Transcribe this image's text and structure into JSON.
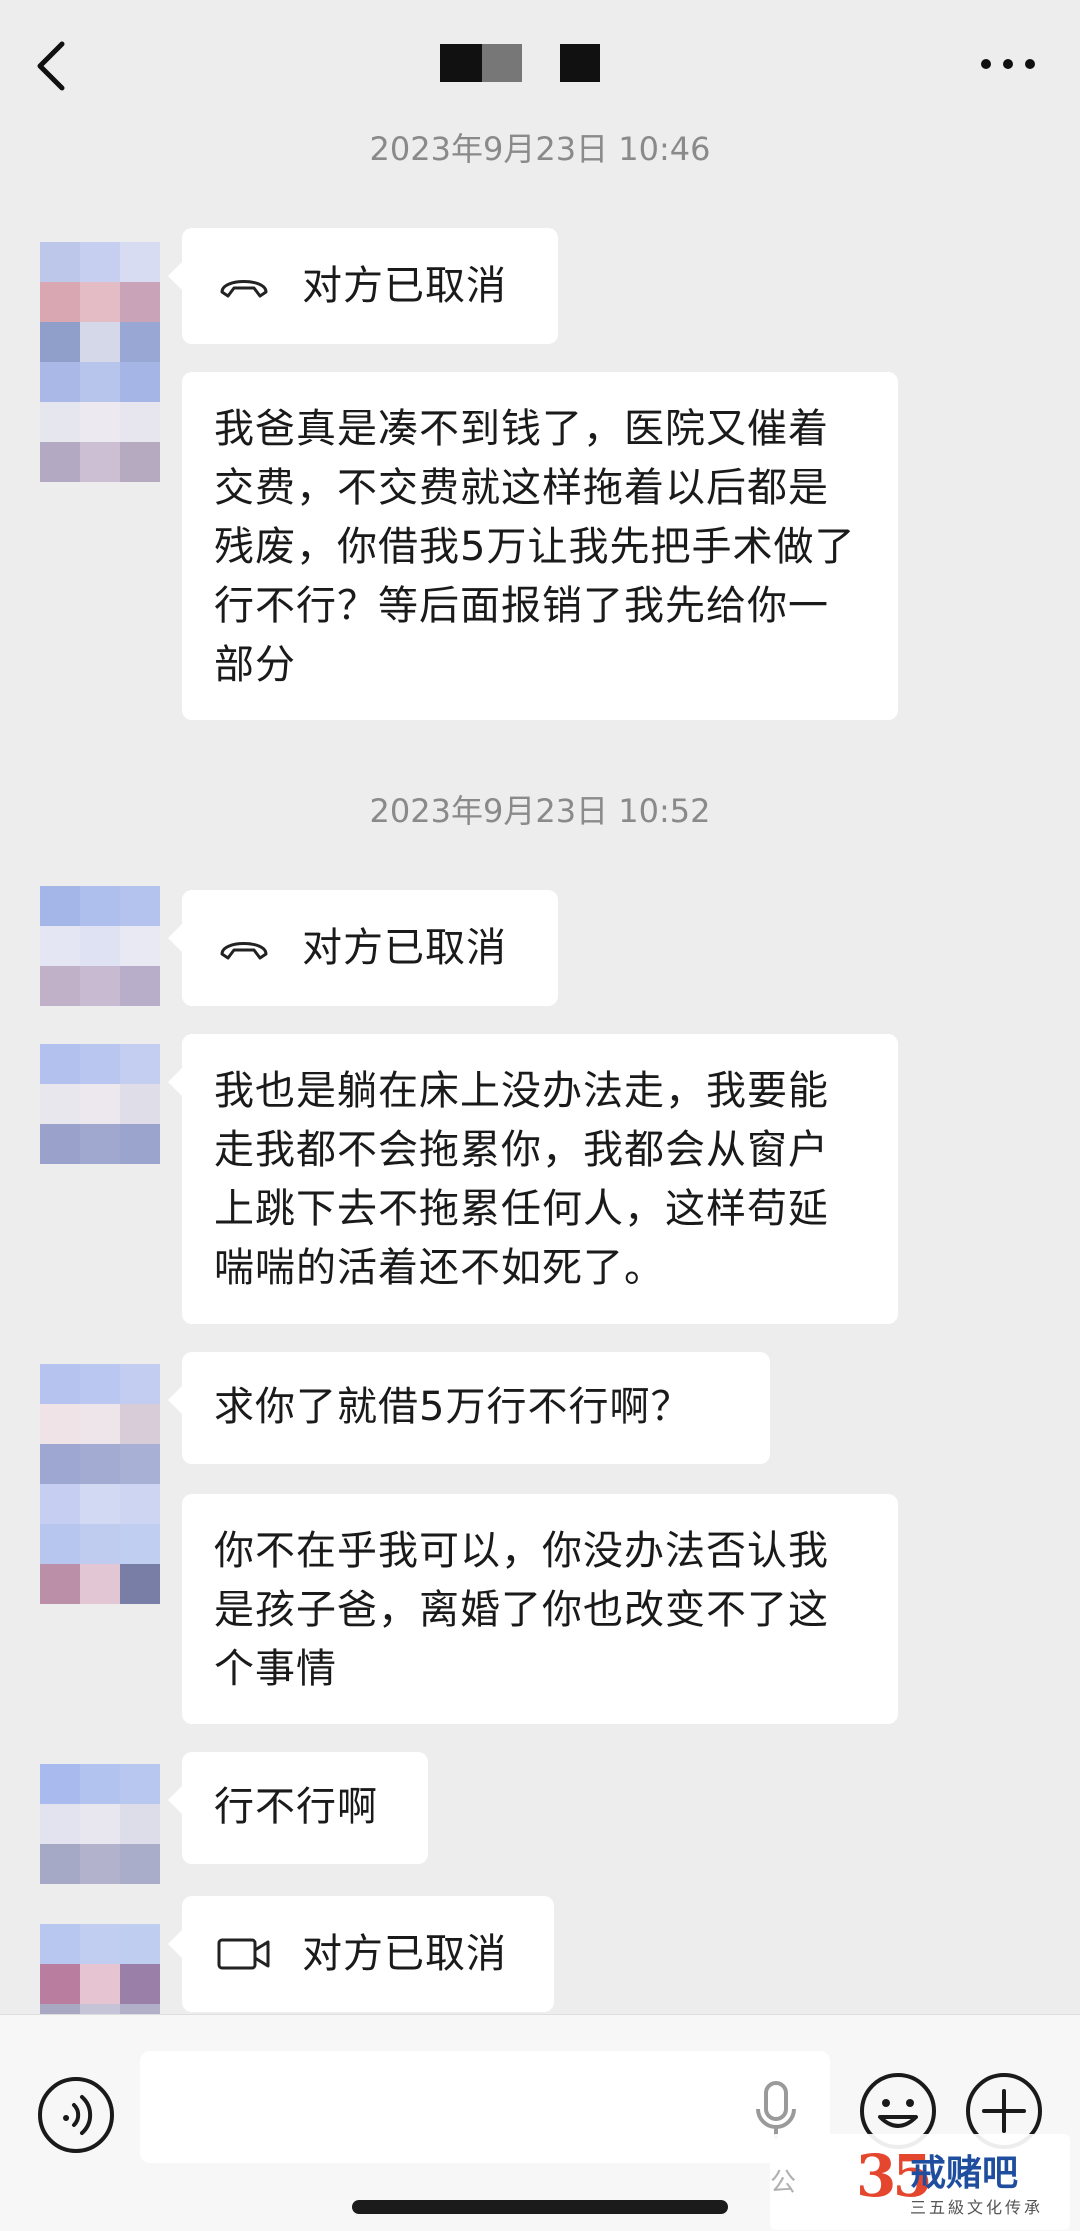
{
  "header": {
    "back_icon": "chevron-left-icon",
    "more_icon": "more-horizontal-icon"
  },
  "messages": [
    {
      "type": "timestamp",
      "text": "2023年9月23日 10:46"
    },
    {
      "type": "voice_call",
      "icon": "phone-hangup-icon",
      "text": "对方已取消"
    },
    {
      "type": "text",
      "text": "我爸真是凑不到钱了，医院又催着交费，不交费就这样拖着以后都是残废，你借我5万让我先把手术做了行不行？等后面报销了我先给你一部分"
    },
    {
      "type": "timestamp",
      "text": "2023年9月23日 10:52"
    },
    {
      "type": "voice_call",
      "icon": "phone-hangup-icon",
      "text": "对方已取消"
    },
    {
      "type": "text",
      "text": "我也是躺在床上没办法走，我要能走我都不会拖累你，我都会从窗户上跳下去不拖累任何人，这样苟延喘喘的活着还不如死了。"
    },
    {
      "type": "text",
      "text": "求你了就借5万行不行啊？"
    },
    {
      "type": "text",
      "text": "你不在乎我可以，你没办法否认我是孩子爸，离婚了你也改变不了这个事情"
    },
    {
      "type": "text",
      "text": "行不行啊"
    },
    {
      "type": "video_call",
      "icon": "video-camera-icon",
      "text": "对方已取消"
    }
  ],
  "input_bar": {
    "voice_icon": "voice-mode-icon",
    "input_value": "",
    "mic_icon": "microphone-icon",
    "emoji_icon": "emoji-icon",
    "plus_icon": "plus-circle-icon"
  },
  "watermark": {
    "small": "公",
    "logo_number": "35",
    "title": "戒赌吧",
    "subtitle": "三五級文化传承"
  }
}
